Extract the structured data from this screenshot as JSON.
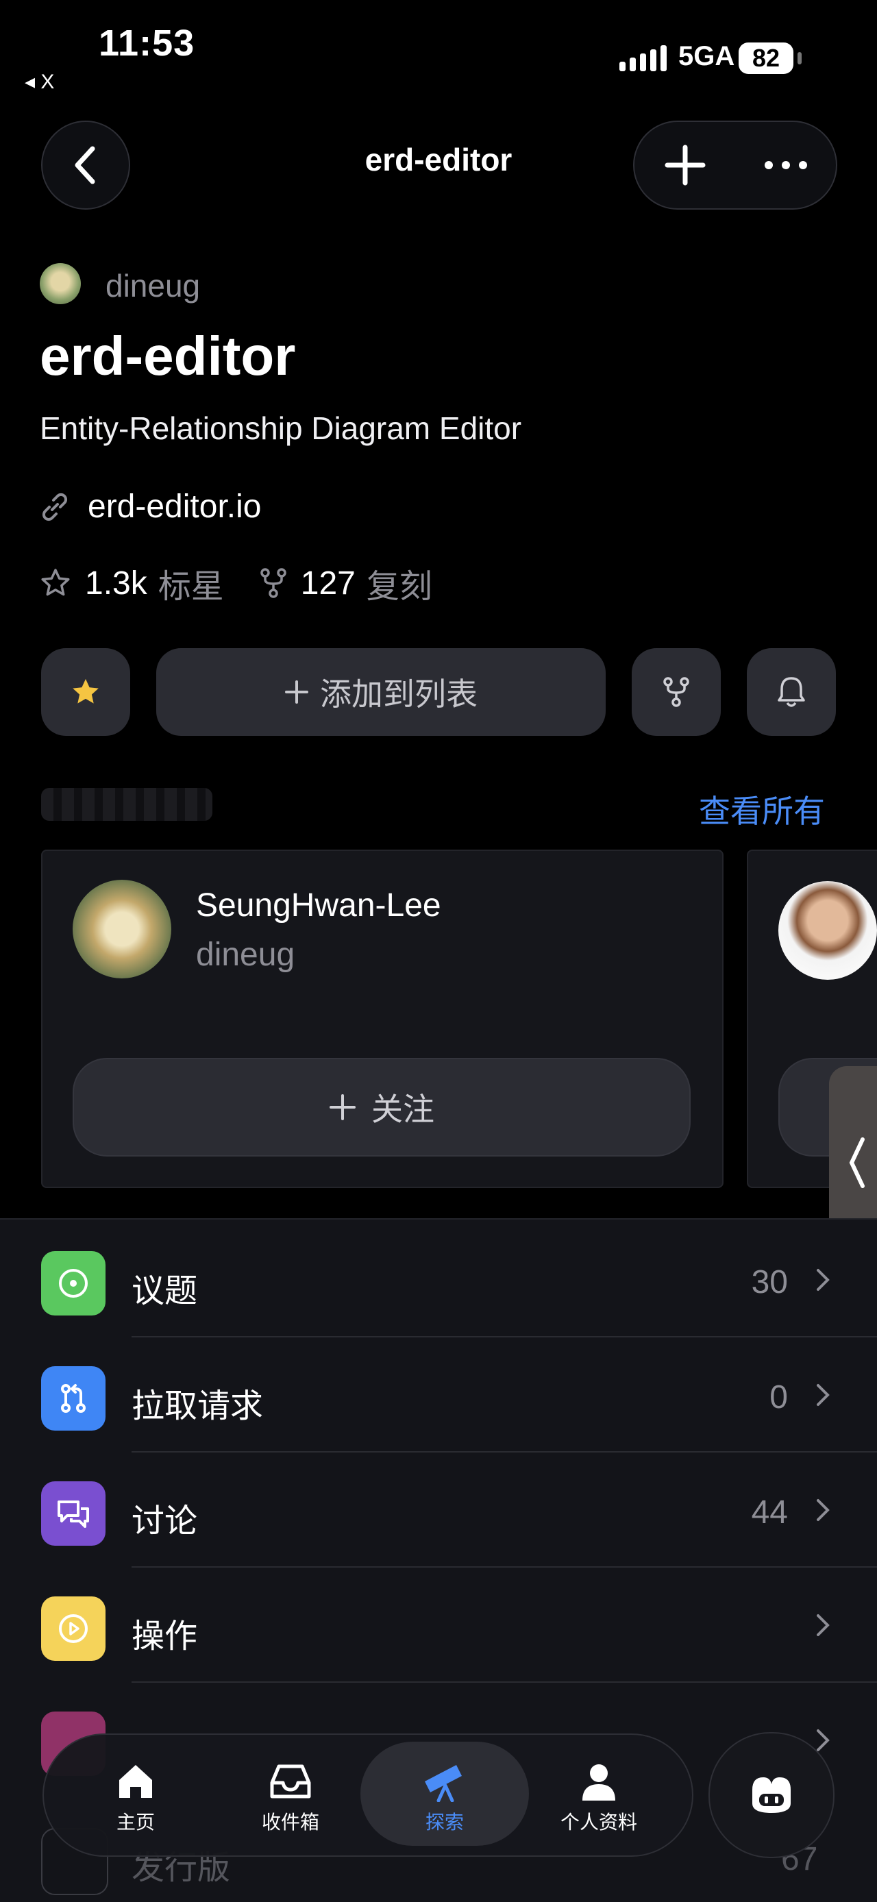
{
  "status_bar": {
    "time": "11:53",
    "back_app": "◂ X",
    "network": "5GA",
    "battery": "82"
  },
  "header": {
    "title": "erd-editor"
  },
  "repo": {
    "owner": "dineug",
    "name": "erd-editor",
    "description": "Entity-Relationship Diagram Editor",
    "link": "erd-editor.io",
    "stars": {
      "count": "1.3k",
      "label": "标星"
    },
    "forks": {
      "count": "127",
      "label": "复刻"
    }
  },
  "actions": {
    "add_to_list": "添加到列表"
  },
  "contributors": {
    "view_all": "查看所有",
    "items": [
      {
        "name": "SeungHwan-Lee",
        "login": "dineug",
        "follow": "关注"
      }
    ]
  },
  "menu": [
    {
      "label": "议题",
      "count": "30",
      "color": "#5ac85f",
      "icon": "issue-icon"
    },
    {
      "label": "拉取请求",
      "count": "0",
      "color": "#3f86f5",
      "icon": "pull-request-icon"
    },
    {
      "label": "讨论",
      "count": "44",
      "color": "#7a4fd0",
      "icon": "discussion-icon"
    },
    {
      "label": "操作",
      "count": "",
      "color": "#f5d35a",
      "icon": "actions-icon"
    },
    {
      "label": "",
      "count": "",
      "color": "#b03a7a",
      "icon": "project-icon"
    }
  ],
  "partial_row": {
    "label": "发行版",
    "count": "67",
    "icon": "tag-icon"
  },
  "tabbar": {
    "home": "主页",
    "inbox": "收件箱",
    "explore": "探索",
    "profile": "个人资料",
    "active_color": "#4a8cf7"
  }
}
